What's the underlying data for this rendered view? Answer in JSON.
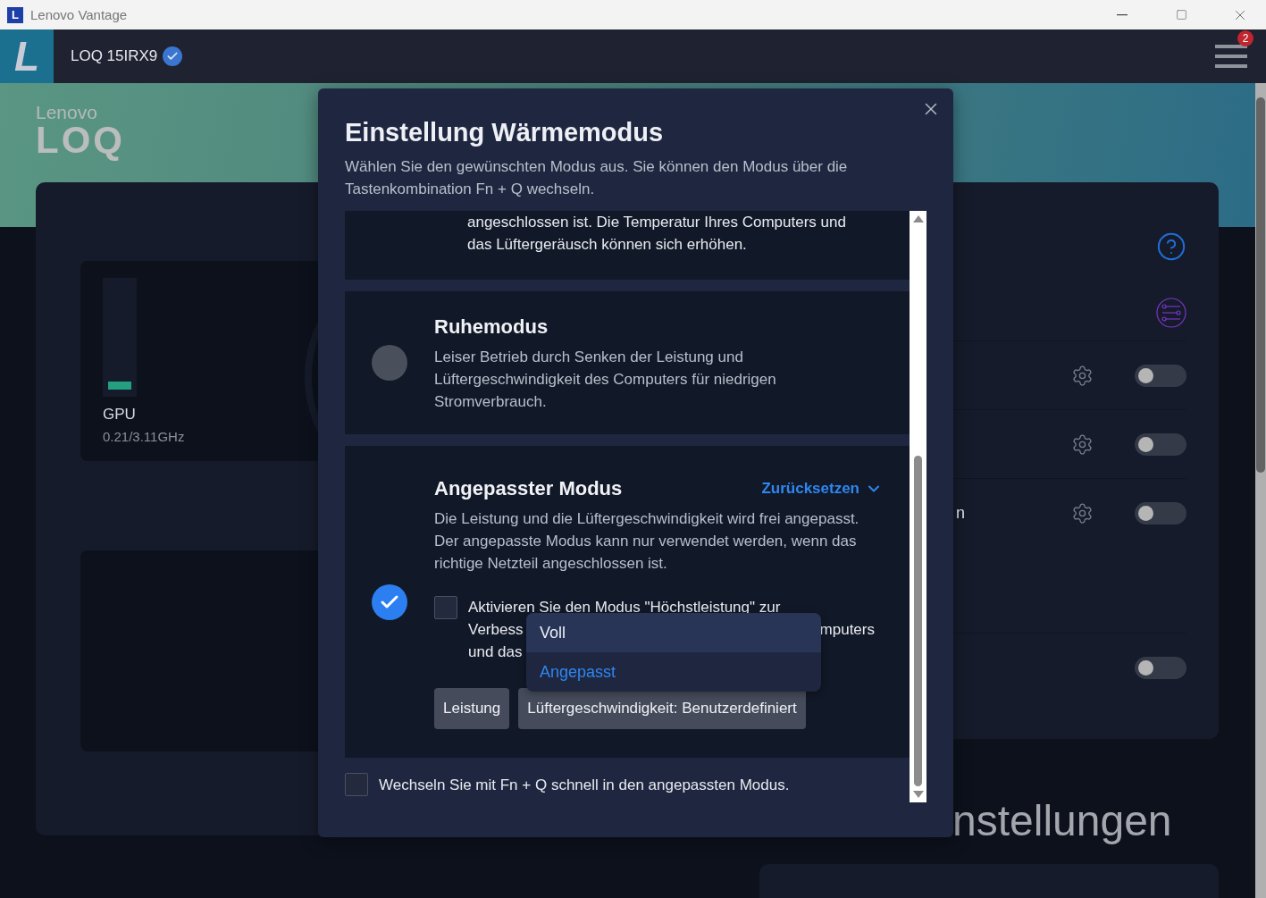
{
  "window": {
    "title": "Lenovo Vantage",
    "app_icon": "L"
  },
  "header": {
    "logo": "L",
    "device": "LOQ 15IRX9",
    "verified": true,
    "notifications": "2"
  },
  "hero": {
    "brand": "Lenovo",
    "product": "LOQ"
  },
  "gpu": {
    "label": "GPU",
    "reading": "0.21/3.11GHz",
    "level": 0.07
  },
  "settings_rows": [
    {
      "kind": "gear-toggle",
      "on": false
    },
    {
      "kind": "gear-toggle",
      "on": false
    },
    {
      "kind": "gear-toggle",
      "label": "n",
      "on": false
    },
    {
      "kind": "toggle",
      "on": false
    }
  ],
  "section_heading": "nstellungen",
  "dialog": {
    "title": "Einstellung Wärmemodus",
    "subtitle": "Wählen Sie den gewünschten Modus aus. Sie können den Modus über die Tastenkombination Fn + Q wechseln.",
    "partial_text": "angeschlossen ist. Die Temperatur Ihres Computers und das Lüftergeräusch können sich erhöhen.",
    "modes": [
      {
        "title": "Ruhemodus",
        "description": "Leiser Betrieb durch Senken der Leistung und Lüftergeschwindigkeit des Computers für niedrigen Stromverbrauch.",
        "selected": false
      },
      {
        "title": "Angepasster Modus",
        "description": "Die Leistung und die Lüftergeschwindigkeit wird frei angepasst. Der angepasste Modus kann nur verwendet werden, wenn das richtige Netzteil angeschlossen ist.",
        "selected": true,
        "reset_link": "Zurücksetzen"
      }
    ],
    "custom": {
      "checkbox": {
        "checked": false,
        "line_1": "Aktivieren Sie den Modus \"Höchstleistung\" zur",
        "line_2_start": "Verbess",
        "line_2_end": "mputers",
        "line_3": "und das"
      },
      "dropdown": [
        {
          "label": "Voll",
          "hovered": true,
          "selected": false
        },
        {
          "label": "Angepasst",
          "hovered": false,
          "selected": true
        }
      ],
      "buttons": [
        "Leistung",
        "Lüftergeschwindigkeit: Benutzerdefiniert"
      ]
    },
    "quick_switch": {
      "label": "Wechseln Sie mit Fn + Q schnell in den angepassten Modus.",
      "checked": false
    }
  }
}
